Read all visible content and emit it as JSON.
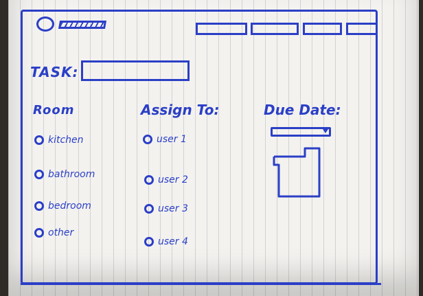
{
  "header": {
    "nav_items": [
      "",
      "",
      "",
      ""
    ]
  },
  "form": {
    "task_label": "TASK:",
    "task_value": "",
    "room": {
      "heading": "Room",
      "options": [
        "kitchen",
        "bathroom",
        "bedroom",
        "other"
      ]
    },
    "assign": {
      "heading": "Assign To:",
      "options": [
        "user 1",
        "user 2",
        "user 3",
        "user 4"
      ]
    },
    "due": {
      "heading": "Due Date:",
      "date_value": ""
    }
  },
  "colors": {
    "ink": "#2b3fc6",
    "paper": "#f3f2ef"
  },
  "icons": {
    "logo": "logo-circle-icon",
    "dropdown": "chevron-down-icon",
    "calendar": "calendar-icon"
  }
}
